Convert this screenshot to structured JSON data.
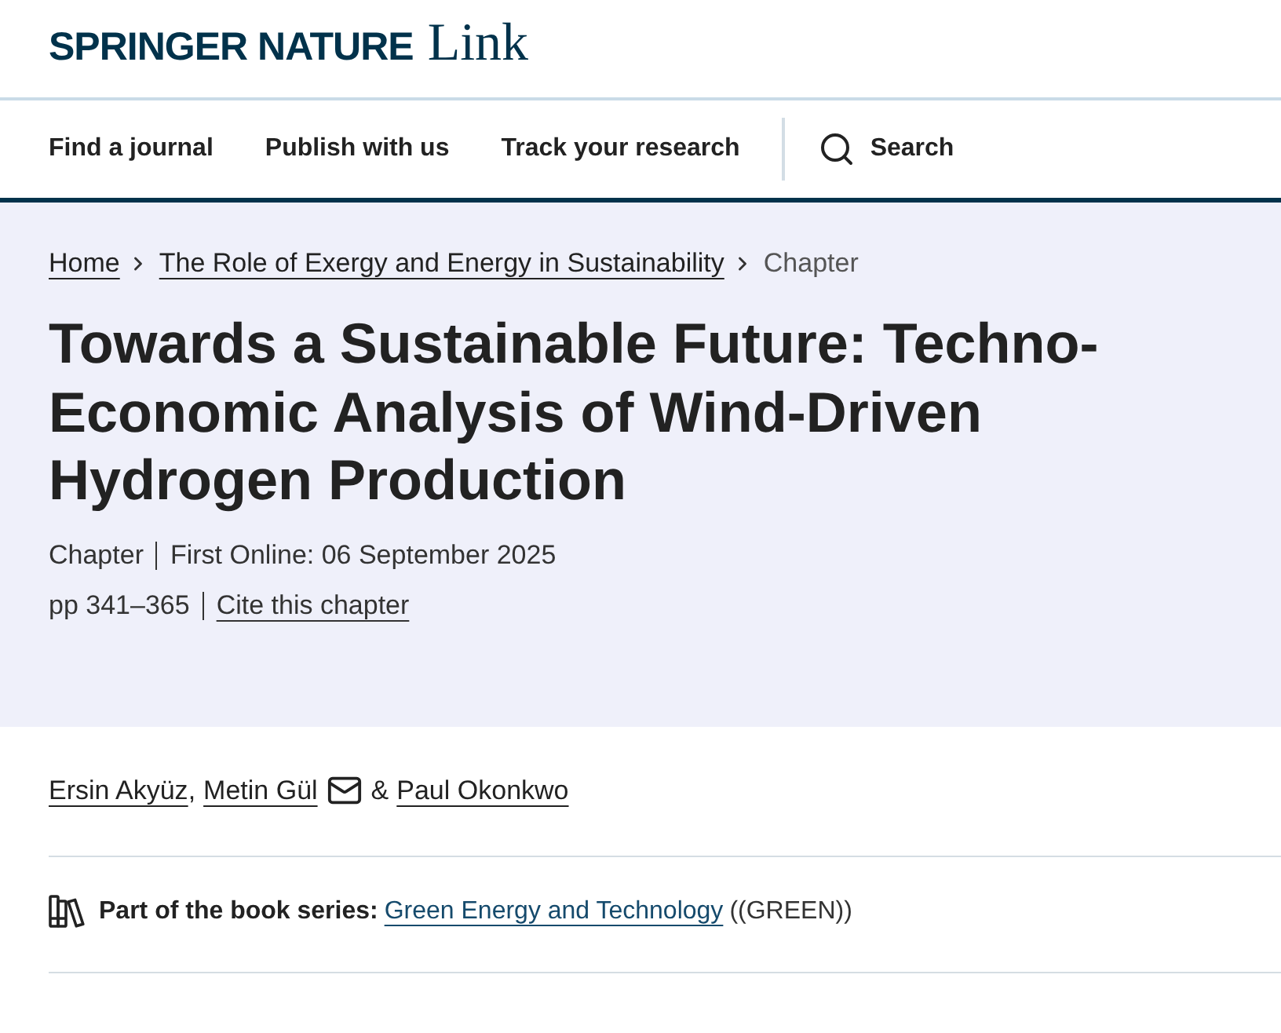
{
  "header": {
    "logo": {
      "wordmark": "SPRINGER NATURE",
      "product": "Link"
    }
  },
  "nav": {
    "items": [
      "Find a journal",
      "Publish with us",
      "Track your research"
    ],
    "search": "Search"
  },
  "breadcrumb": [
    {
      "label": "Home",
      "kind": "link"
    },
    {
      "label": "The Role of Exergy and Energy in Sustainability",
      "kind": "link"
    },
    {
      "label": "Chapter",
      "kind": "current"
    }
  ],
  "article": {
    "title": "Towards a Sustainable Future: Techno-Economic Analysis of Wind-Driven Hydrogen Production",
    "meta": [
      {
        "items": [
          {
            "text": "Chapter",
            "kind": "text"
          },
          {
            "text": "First Online: 06 September 2025",
            "kind": "text"
          }
        ]
      },
      {
        "items": [
          {
            "text": "pp 341–365",
            "kind": "text"
          },
          {
            "text": "Cite this chapter",
            "kind": "link"
          }
        ]
      }
    ]
  },
  "authors": [
    {
      "name": "Ersin Akyüz",
      "email": false,
      "after": ","
    },
    {
      "name": "Metin Gül",
      "email": true,
      "after": "&"
    },
    {
      "name": "Paul Okonkwo",
      "email": false
    }
  ],
  "series": {
    "label": "Part of the book series:",
    "name": "Green Energy and Technology",
    "abbreviation": "((GREEN))"
  }
}
